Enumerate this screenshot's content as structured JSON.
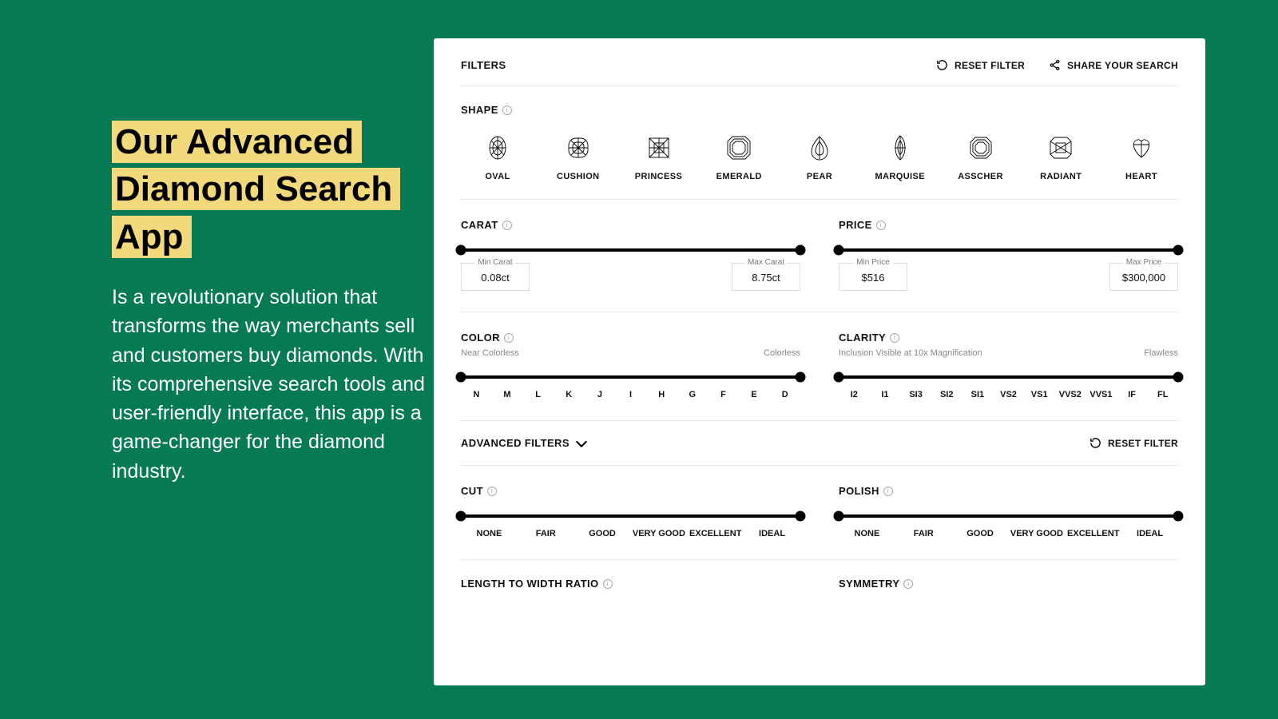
{
  "left": {
    "headline_line1": "Our Advanced",
    "headline_line2": "Diamond Search App",
    "body": "Is a revolutionary solution that transforms the way merchants sell and customers buy diamonds. With its comprehensive search tools and user-friendly interface, this app is a game-changer for the diamond industry."
  },
  "top": {
    "filters_label": "FILTERS",
    "reset_label": "RESET FILTER",
    "share_label": "SHARE YOUR SEARCH"
  },
  "shape": {
    "label": "SHAPE",
    "items": [
      "OVAL",
      "CUSHION",
      "PRINCESS",
      "EMERALD",
      "PEAR",
      "MARQUISE",
      "ASSCHER",
      "RADIANT",
      "HEART"
    ]
  },
  "carat": {
    "label": "CARAT",
    "min_label": "Min Carat",
    "min_value": "0.08ct",
    "max_label": "Max Carat",
    "max_value": "8.75ct"
  },
  "price": {
    "label": "PRICE",
    "min_label": "Min Price",
    "min_value": "$516",
    "max_label": "Max Price",
    "max_value": "$300,000"
  },
  "color": {
    "label": "COLOR",
    "left_hint": "Near Colorless",
    "right_hint": "Colorless",
    "ticks": [
      "N",
      "M",
      "L",
      "K",
      "J",
      "I",
      "H",
      "G",
      "F",
      "E",
      "D"
    ]
  },
  "clarity": {
    "label": "CLARITY",
    "left_hint": "Inclusion Visible at 10x Magnification",
    "right_hint": "Flawless",
    "ticks": [
      "I2",
      "I1",
      "SI3",
      "SI2",
      "SI1",
      "VS2",
      "VS1",
      "VVS2",
      "VVS1",
      "IF",
      "FL"
    ]
  },
  "advanced": {
    "label": "ADVANCED FILTERS",
    "reset_label": "RESET FILTER"
  },
  "cut": {
    "label": "CUT",
    "ticks": [
      "NONE",
      "FAIR",
      "GOOD",
      "VERY GOOD",
      "EXCELLENT",
      "IDEAL"
    ]
  },
  "polish": {
    "label": "POLISH",
    "ticks": [
      "NONE",
      "FAIR",
      "GOOD",
      "VERY GOOD",
      "EXCELLENT",
      "IDEAL"
    ]
  },
  "lwr": {
    "label": "LENGTH TO WIDTH RATIO"
  },
  "symmetry": {
    "label": "SYMMETRY"
  }
}
